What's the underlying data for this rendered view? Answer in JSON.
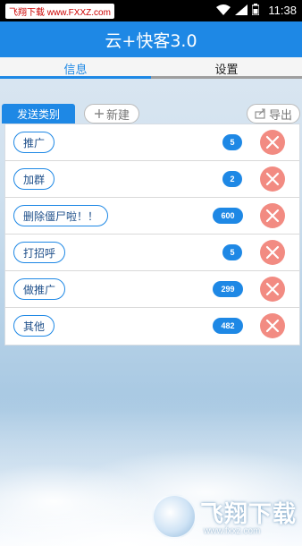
{
  "status_bar": {
    "carrier_text": "飞翔下载 www.FXXZ.com",
    "time": "11:38"
  },
  "app": {
    "title": "云+快客3.0"
  },
  "tabs": [
    {
      "label": "信息",
      "active": true
    },
    {
      "label": "设置",
      "active": false
    }
  ],
  "toolbar": {
    "type_tab_label": "发送类别",
    "new_label": "新建",
    "export_label": "导出"
  },
  "categories": [
    {
      "label": "推广",
      "count": "5"
    },
    {
      "label": "加群",
      "count": "2"
    },
    {
      "label": "删除僵尸啦！！",
      "count": "600"
    },
    {
      "label": "打招呼",
      "count": "5"
    },
    {
      "label": "做推广",
      "count": "299"
    },
    {
      "label": "其他",
      "count": "482"
    }
  ],
  "watermark": {
    "text": "飞翔下载",
    "url": "www.fxxz.com"
  },
  "colors": {
    "accent": "#1e88e5",
    "delete": "#f28b82"
  }
}
